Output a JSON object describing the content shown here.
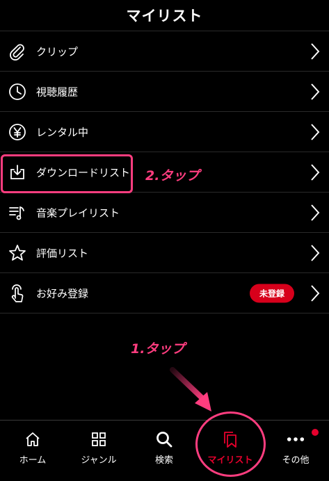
{
  "header": {
    "title": "マイリスト"
  },
  "menu": [
    {
      "label": "クリップ",
      "icon": "paperclip-icon"
    },
    {
      "label": "視聴履歴",
      "icon": "clock-icon"
    },
    {
      "label": "レンタル中",
      "icon": "yen-icon"
    },
    {
      "label": "ダウンロードリスト",
      "icon": "download-icon"
    },
    {
      "label": "音楽プレイリスト",
      "icon": "music-list-icon"
    },
    {
      "label": "評価リスト",
      "icon": "star-icon"
    },
    {
      "label": "お好み登録",
      "icon": "finger-tap-icon",
      "badge": "未登録"
    }
  ],
  "annotations": {
    "step2": "2.タップ",
    "step1": "1.タップ"
  },
  "tabs": [
    {
      "label": "ホーム",
      "icon": "home-icon"
    },
    {
      "label": "ジャンル",
      "icon": "grid-icon"
    },
    {
      "label": "検索",
      "icon": "search-icon"
    },
    {
      "label": "マイリスト",
      "icon": "bookmark-icon",
      "active": true
    },
    {
      "label": "その他",
      "icon": "more-icon"
    }
  ],
  "colors": {
    "accent": "#e6002d",
    "annotation": "#ff3d7f",
    "badge": "#d7001b"
  }
}
